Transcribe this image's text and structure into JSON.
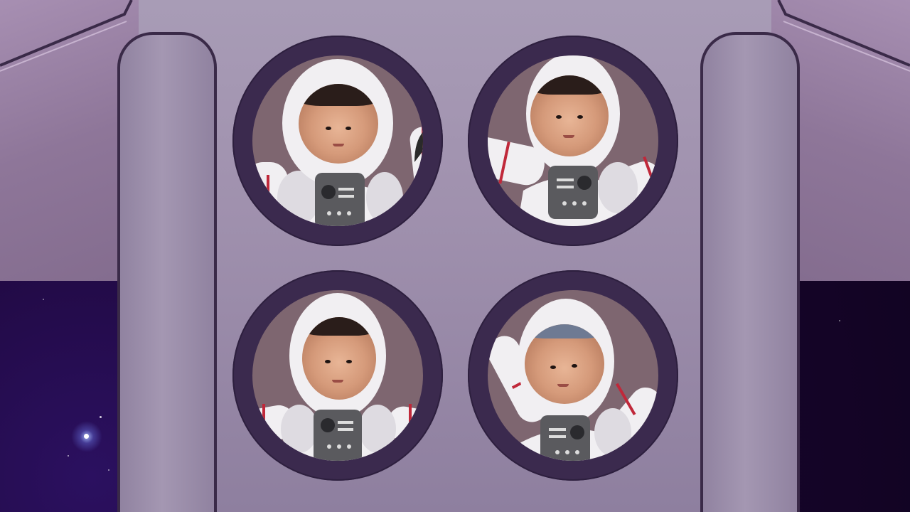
{
  "scene": {
    "type": "spaceship-interior-video-call",
    "portholes": [
      {
        "id": 1,
        "position": "top-left",
        "pose": "waving-right-hand"
      },
      {
        "id": 2,
        "position": "top-right",
        "pose": "arm-out-left"
      },
      {
        "id": 3,
        "position": "bottom-left",
        "pose": "arms-down"
      },
      {
        "id": 4,
        "position": "bottom-right",
        "pose": "arms-up-waving"
      }
    ]
  },
  "colors": {
    "frame": "#3b2a4e",
    "window_bg": "#7e6670",
    "suit": "#f1eff2",
    "suit_shadow": "#c9c4cc",
    "suit_stripe": "#c0283a",
    "panel": "#5a5a5e",
    "space": "#1a0630"
  }
}
